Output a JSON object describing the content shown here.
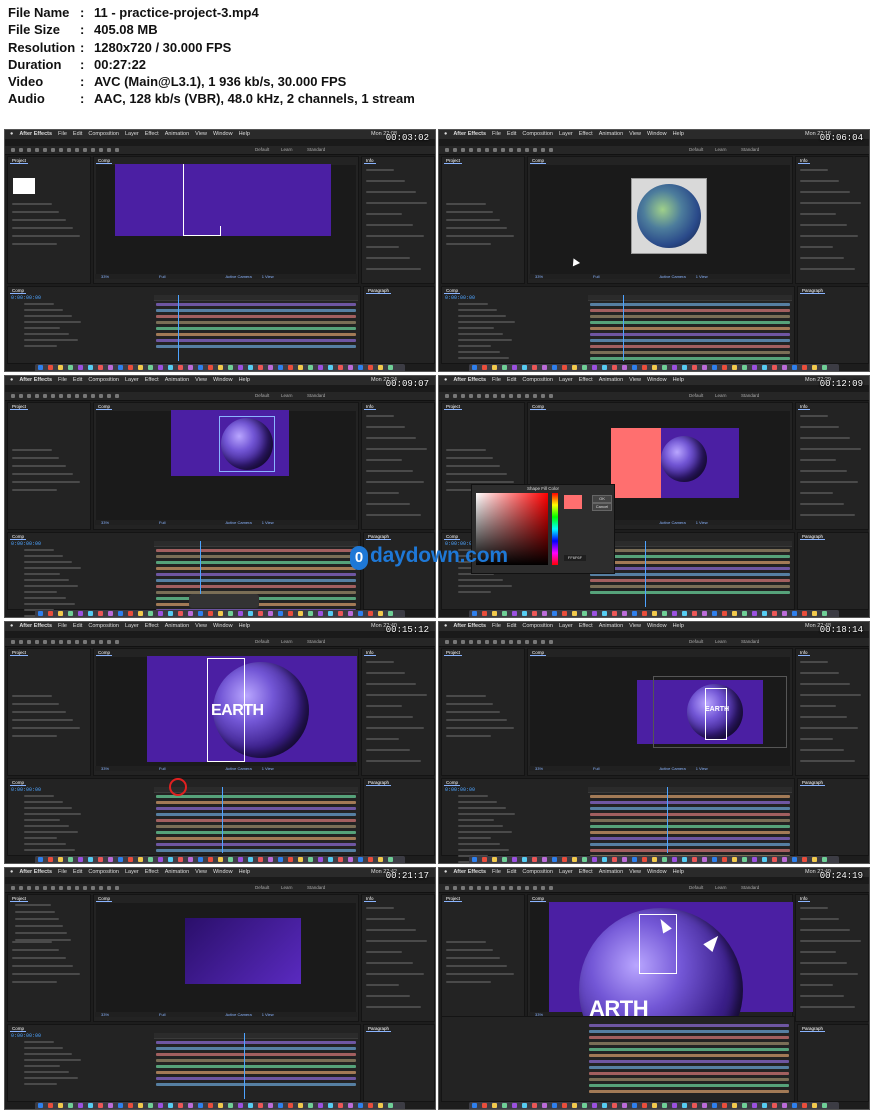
{
  "info": {
    "rows": [
      {
        "key": "File Name",
        "sep": ":",
        "value": "11 - practice-project-3.mp4"
      },
      {
        "key": "File Size",
        "sep": ":",
        "value": "405.08 MB"
      },
      {
        "key": "Resolution",
        "sep": ":",
        "value": "1280x720 / 30.000 FPS"
      },
      {
        "key": "Duration",
        "sep": ":",
        "value": "00:27:22"
      },
      {
        "key": "Video",
        "sep": ":",
        "value": "AVC (Main@L3.1), 1 936 kb/s, 30.000 FPS"
      },
      {
        "key": "Audio",
        "sep": ":",
        "value": "AAC, 128 kb/s (VBR), 48.0 kHz, 2 channels, 1 stream"
      }
    ]
  },
  "app": {
    "name": "After Effects",
    "menus": [
      "File",
      "Edit",
      "Composition",
      "Layer",
      "Effect",
      "Animation",
      "View",
      "Window",
      "Help"
    ],
    "workspace": [
      "Default",
      "Learn",
      "Standard"
    ],
    "timecode": "0:00:00:00",
    "viewer_zoom": "33%",
    "viewer_quality": "Full",
    "viewer_camera": "Active Camera",
    "viewer_views": "1 View"
  },
  "thumbnails": [
    {
      "timestamp": "00:03:02",
      "clock": "Mon 22:08",
      "scene": "purple-bracket"
    },
    {
      "timestamp": "00:06:04",
      "clock": "Mon 22:16",
      "scene": "earth-photo"
    },
    {
      "timestamp": "00:09:07",
      "clock": "Mon 22:24",
      "scene": "purple-earth"
    },
    {
      "timestamp": "00:12:09",
      "clock": "Mon 22:29",
      "scene": "color-picker"
    },
    {
      "timestamp": "00:15:12",
      "clock": "Mon 22:40",
      "scene": "earth-text-large",
      "comp_text": "EARTH"
    },
    {
      "timestamp": "00:18:14",
      "clock": "Mon 22:48",
      "scene": "earth-text-small",
      "comp_text": "EARTH"
    },
    {
      "timestamp": "00:21:17",
      "clock": "Mon 22:42",
      "scene": "gradient"
    },
    {
      "timestamp": "00:24:19",
      "clock": "Mon 22:49",
      "scene": "zoom-earth",
      "comp_text": "ARTH"
    }
  ],
  "color_picker": {
    "title": "Shape Fill Color",
    "ok_label": "OK",
    "cancel_label": "Cancel",
    "hex_value": "FF6F6F",
    "swatch_color": "#ff6f6f"
  },
  "watermark": {
    "badge": "0",
    "text": "daydown.com"
  },
  "colors": {
    "comp_purple": "#4b1fa3",
    "playhead": "#4da3ff",
    "picker_red": "#ff6f6f"
  }
}
